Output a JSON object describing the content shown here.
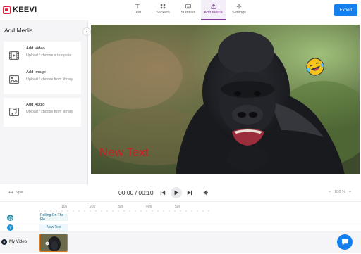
{
  "app": {
    "name": "KEEVI"
  },
  "nav": {
    "tabs": [
      {
        "label": "Text",
        "icon": "text-icon"
      },
      {
        "label": "Stickers",
        "icon": "stickers-icon"
      },
      {
        "label": "Subtitles",
        "icon": "subtitles-icon"
      },
      {
        "label": "Add Media",
        "icon": "upload-icon",
        "active": true
      },
      {
        "label": "Settings",
        "icon": "gear-icon"
      }
    ],
    "export_label": "Export"
  },
  "sidebar": {
    "title": "Add Media",
    "cards": [
      {
        "title": "Add Video",
        "desc": "Upload / choose a template",
        "icon": "video-icon"
      },
      {
        "title": "Add Image",
        "desc": "Upload / choose from library",
        "icon": "image-icon"
      },
      {
        "title": "Add Audio",
        "desc": "Upload / choose from library",
        "icon": "audio-icon"
      }
    ]
  },
  "preview": {
    "text_overlay": "New Text",
    "text_color": "#c81e24",
    "sticker": "laughing-emoji"
  },
  "controls": {
    "split_label": "Split",
    "current_time": "00:00",
    "total_time": "00:10",
    "timecode_separator": " / ",
    "zoom": "100 %"
  },
  "timeline": {
    "ruler": [
      "10s",
      "20s",
      "30s",
      "40s",
      "50s"
    ],
    "tracks": [
      {
        "label": "Rolling On The Flo",
        "icon": "sticker-track-icon"
      },
      {
        "label": "New Text",
        "icon": "text-track-icon"
      }
    ],
    "video_track_label": "My Video"
  },
  "colors": {
    "accent": "#1480f0",
    "active_tab": "#7a3b8f",
    "brand": "#e0253a",
    "clip_border": "#e07b1f"
  }
}
